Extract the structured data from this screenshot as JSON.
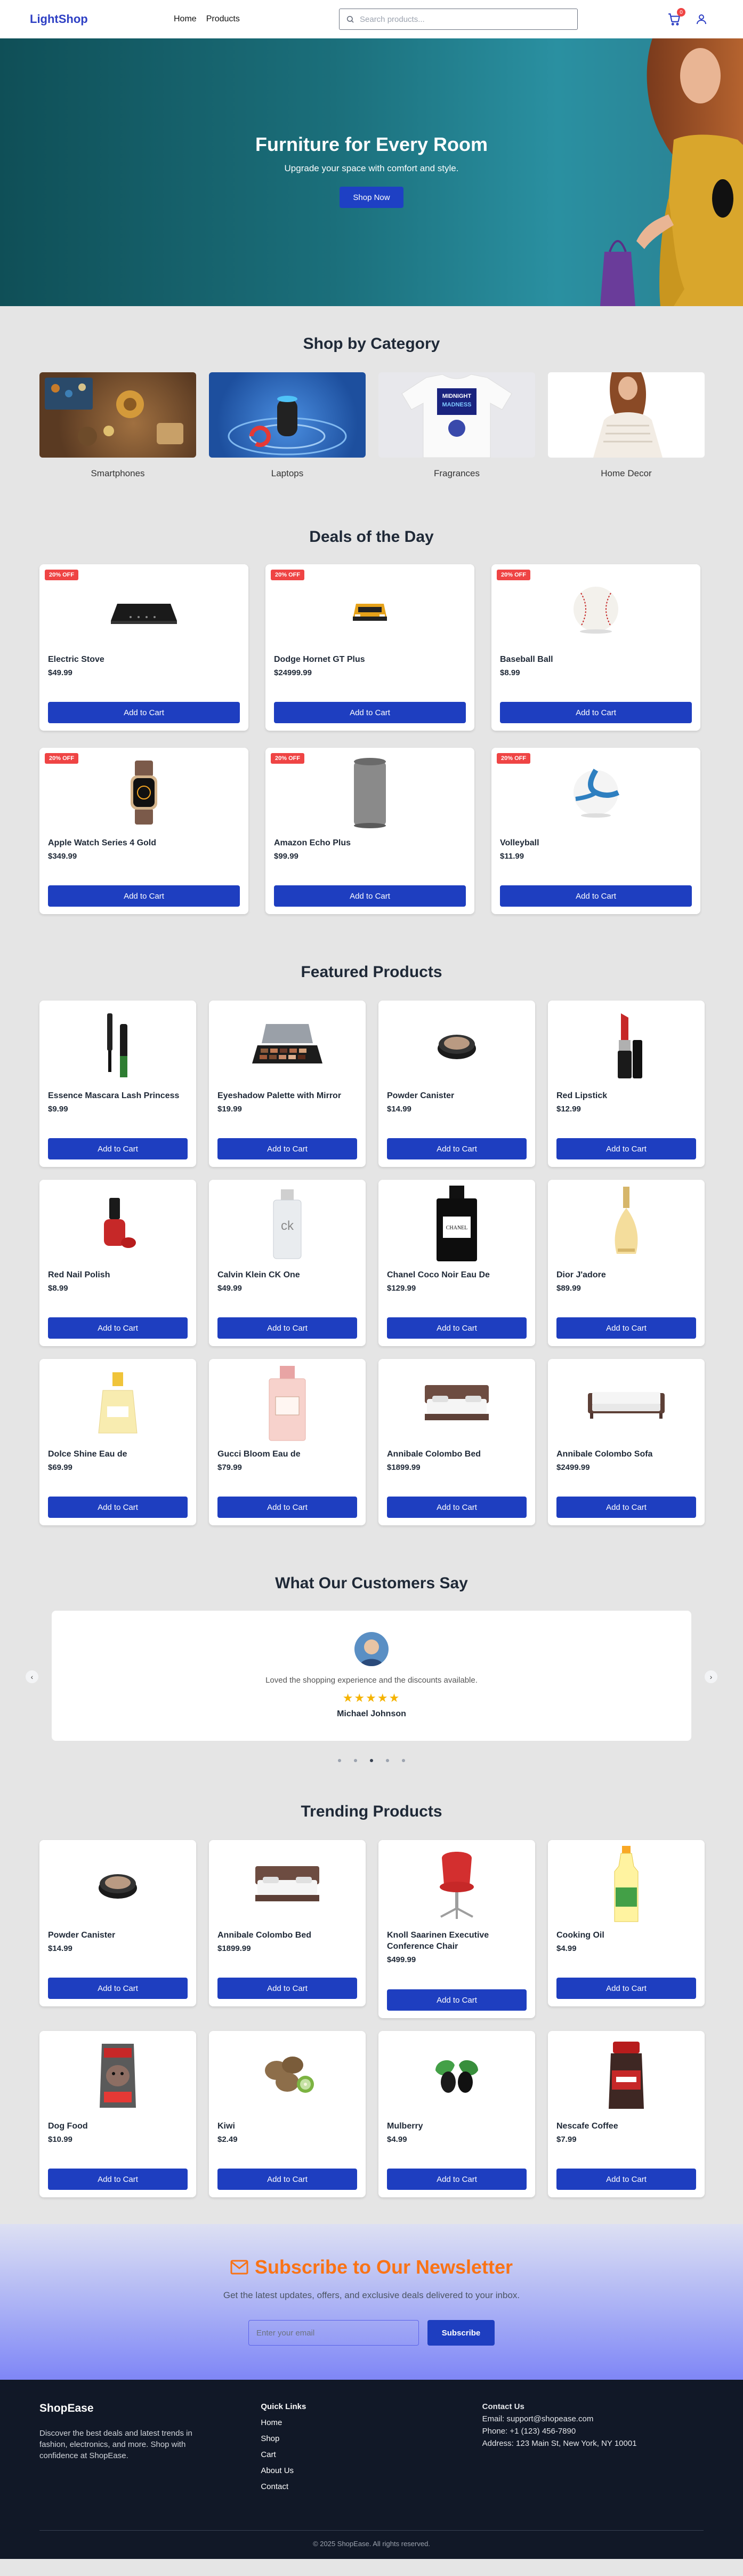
{
  "header": {
    "logo": "LightShop",
    "nav": [
      "Home",
      "Products"
    ],
    "search_placeholder": "Search products...",
    "cart_count": "0"
  },
  "hero": {
    "title": "Furniture for Every Room",
    "subtitle": "Upgrade your space with comfort and style.",
    "cta": "Shop Now"
  },
  "categories": {
    "title": "Shop by Category",
    "items": [
      "Smartphones",
      "Laptops",
      "Fragrances",
      "Home Decor"
    ],
    "shirt_text": [
      "MIDNIGHT",
      "MADNESS"
    ]
  },
  "deals": {
    "title": "Deals of the Day",
    "items": [
      {
        "badge": "20% OFF",
        "name": "Electric Stove",
        "price": "$49.99",
        "button": "Add to Cart"
      },
      {
        "badge": "20% OFF",
        "name": "Dodge Hornet GT Plus",
        "price": "$24999.99",
        "button": "Add to Cart"
      },
      {
        "badge": "20% OFF",
        "name": "Baseball Ball",
        "price": "$8.99",
        "button": "Add to Cart"
      },
      {
        "badge": "20% OFF",
        "name": "Apple Watch Series 4 Gold",
        "price": "$349.99",
        "button": "Add to Cart"
      },
      {
        "badge": "20% OFF",
        "name": "Amazon Echo Plus",
        "price": "$99.99",
        "button": "Add to Cart"
      },
      {
        "badge": "20% OFF",
        "name": "Volleyball",
        "price": "$11.99",
        "button": "Add to Cart"
      }
    ]
  },
  "featured": {
    "title": "Featured Products",
    "items": [
      {
        "name": "Essence Mascara Lash Princess",
        "price": "$9.99",
        "button": "Add to Cart"
      },
      {
        "name": "Eyeshadow Palette with Mirror",
        "price": "$19.99",
        "button": "Add to Cart"
      },
      {
        "name": "Powder Canister",
        "price": "$14.99",
        "button": "Add to Cart"
      },
      {
        "name": "Red Lipstick",
        "price": "$12.99",
        "button": "Add to Cart"
      },
      {
        "name": "Red Nail Polish",
        "price": "$8.99",
        "button": "Add to Cart"
      },
      {
        "name": "Calvin Klein CK One",
        "price": "$49.99",
        "button": "Add to Cart"
      },
      {
        "name": "Chanel Coco Noir Eau De",
        "price": "$129.99",
        "button": "Add to Cart"
      },
      {
        "name": "Dior J'adore",
        "price": "$89.99",
        "button": "Add to Cart"
      },
      {
        "name": "Dolce Shine Eau de",
        "price": "$69.99",
        "button": "Add to Cart"
      },
      {
        "name": "Gucci Bloom Eau de",
        "price": "$79.99",
        "button": "Add to Cart"
      },
      {
        "name": "Annibale Colombo Bed",
        "price": "$1899.99",
        "button": "Add to Cart"
      },
      {
        "name": "Annibale Colombo Sofa",
        "price": "$2499.99",
        "button": "Add to Cart"
      }
    ],
    "ck_label": "ck",
    "chanel_label": "CHANEL"
  },
  "testimonials": {
    "title": "What Our Customers Say",
    "text": "Loved the shopping experience and the discounts available.",
    "stars": "★★★★★",
    "name": "Michael Johnson",
    "prev": "‹",
    "next": "›"
  },
  "trending": {
    "title": "Trending Products",
    "items": [
      {
        "name": "Powder Canister",
        "price": "$14.99",
        "button": "Add to Cart"
      },
      {
        "name": "Annibale Colombo Bed",
        "price": "$1899.99",
        "button": "Add to Cart"
      },
      {
        "name": "Knoll Saarinen Executive Conference Chair",
        "price": "$499.99",
        "button": "Add to Cart"
      },
      {
        "name": "Cooking Oil",
        "price": "$4.99",
        "button": "Add to Cart"
      },
      {
        "name": "Dog Food",
        "price": "$10.99",
        "button": "Add to Cart"
      },
      {
        "name": "Kiwi",
        "price": "$2.49",
        "button": "Add to Cart"
      },
      {
        "name": "Mulberry",
        "price": "$4.99",
        "button": "Add to Cart"
      },
      {
        "name": "Nescafe Coffee",
        "price": "$7.99",
        "button": "Add to Cart"
      }
    ]
  },
  "newsletter": {
    "title": "Subscribe to Our Newsletter",
    "subtitle": "Get the latest updates, offers, and exclusive deals delivered to your inbox.",
    "placeholder": "Enter your email",
    "button": "Subscribe"
  },
  "footer": {
    "brand": "ShopEase",
    "about": "Discover the best deals and latest trends in fashion, electronics, and more. Shop with confidence at ShopEase.",
    "links_title": "Quick Links",
    "links": [
      "Home",
      "Shop",
      "Cart",
      "About Us",
      "Contact"
    ],
    "contact_title": "Contact Us",
    "email": "Email: support@shopease.com",
    "phone": "Phone: +1 (123) 456-7890",
    "address": "Address: 123 Main St, New York, NY 10001",
    "copyright": "© 2025 ShopEase. All rights reserved."
  },
  "colors": {
    "brand": "#2d3fc4",
    "button": "#1e3ec0",
    "discount": "#ef4444",
    "newsletter_title": "#f97316",
    "footer_bg": "#111827"
  }
}
